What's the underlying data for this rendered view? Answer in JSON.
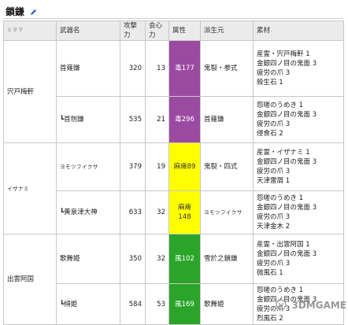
{
  "title": "鎖鎌",
  "headers": [
    "ミタマ",
    "武器名",
    "攻撃力",
    "会心力",
    "属性",
    "派生元",
    "素材"
  ],
  "groups": [
    {
      "mitama": "宍戸梅軒",
      "mitama_small": false,
      "rows": [
        {
          "name": "首薙鎌",
          "atk": "320",
          "crit": "13",
          "element": "毒177",
          "element_type": "poison",
          "origin": "鬼裂・参式",
          "origin_small": false,
          "materials": [
            "産霊・宍戸梅軒 1",
            "金銀四ノ目の鬼面 3",
            "疲労の爪 3",
            "殺生石 1"
          ]
        },
        {
          "name": "┗首刎鎌",
          "atk": "535",
          "crit": "21",
          "element": "毒296",
          "element_type": "poison",
          "origin": "首薙鎌",
          "origin_small": false,
          "materials": [
            "怨嗟のうめき 1",
            "金銀四ノ目の鬼面 3",
            "疲労の爪 3",
            "侵食石 2"
          ]
        }
      ]
    },
    {
      "mitama": "イザナミ",
      "mitama_small": true,
      "rows": [
        {
          "name": "ヨモツフイクサ",
          "name_small": true,
          "atk": "379",
          "crit": "19",
          "element": "麻痺89",
          "element_type": "para",
          "origin": "鬼裂・四式",
          "origin_small": false,
          "materials": [
            "産霊・イザナミ 1",
            "金銀四ノ目の鬼面 3",
            "疲労の爪 3",
            "天津雷屑 1"
          ]
        },
        {
          "name": "┗黄泉津大神",
          "atk": "633",
          "crit": "32",
          "element": "麻痺 148",
          "element_type": "para",
          "origin": "ヨモツフイクサ",
          "origin_small": true,
          "materials": [
            "怨嗟のうめき 1",
            "金銀四ノ目の鬼面 3",
            "疲労の爪 3",
            "天津金木 2"
          ]
        }
      ]
    },
    {
      "mitama": "出雲阿国",
      "mitama_small": false,
      "rows": [
        {
          "name": "歌舞姫",
          "atk": "350",
          "crit": "32",
          "element": "風102",
          "element_type": "wind",
          "origin": "雪於之鎖鎌",
          "origin_small": false,
          "materials": [
            "産霊・出雲阿国 1",
            "金銀四ノ目の鬼面 3",
            "疲労の爪 3",
            "微風石 1"
          ]
        },
        {
          "name": "┗傾姫",
          "atk": "584",
          "crit": "53",
          "element": "風169",
          "element_type": "wind",
          "origin": "歌舞姫",
          "origin_small": false,
          "materials": [
            "怨嗟のうめき 1",
            "金銀四ノ目の鬼面 3",
            "疲労の爪 3",
            "烈風石 2"
          ]
        }
      ]
    }
  ],
  "watermark": "3DMGAME",
  "icons": {
    "edit": "pencil-icon",
    "watermark": "3dm-logo-icon"
  }
}
